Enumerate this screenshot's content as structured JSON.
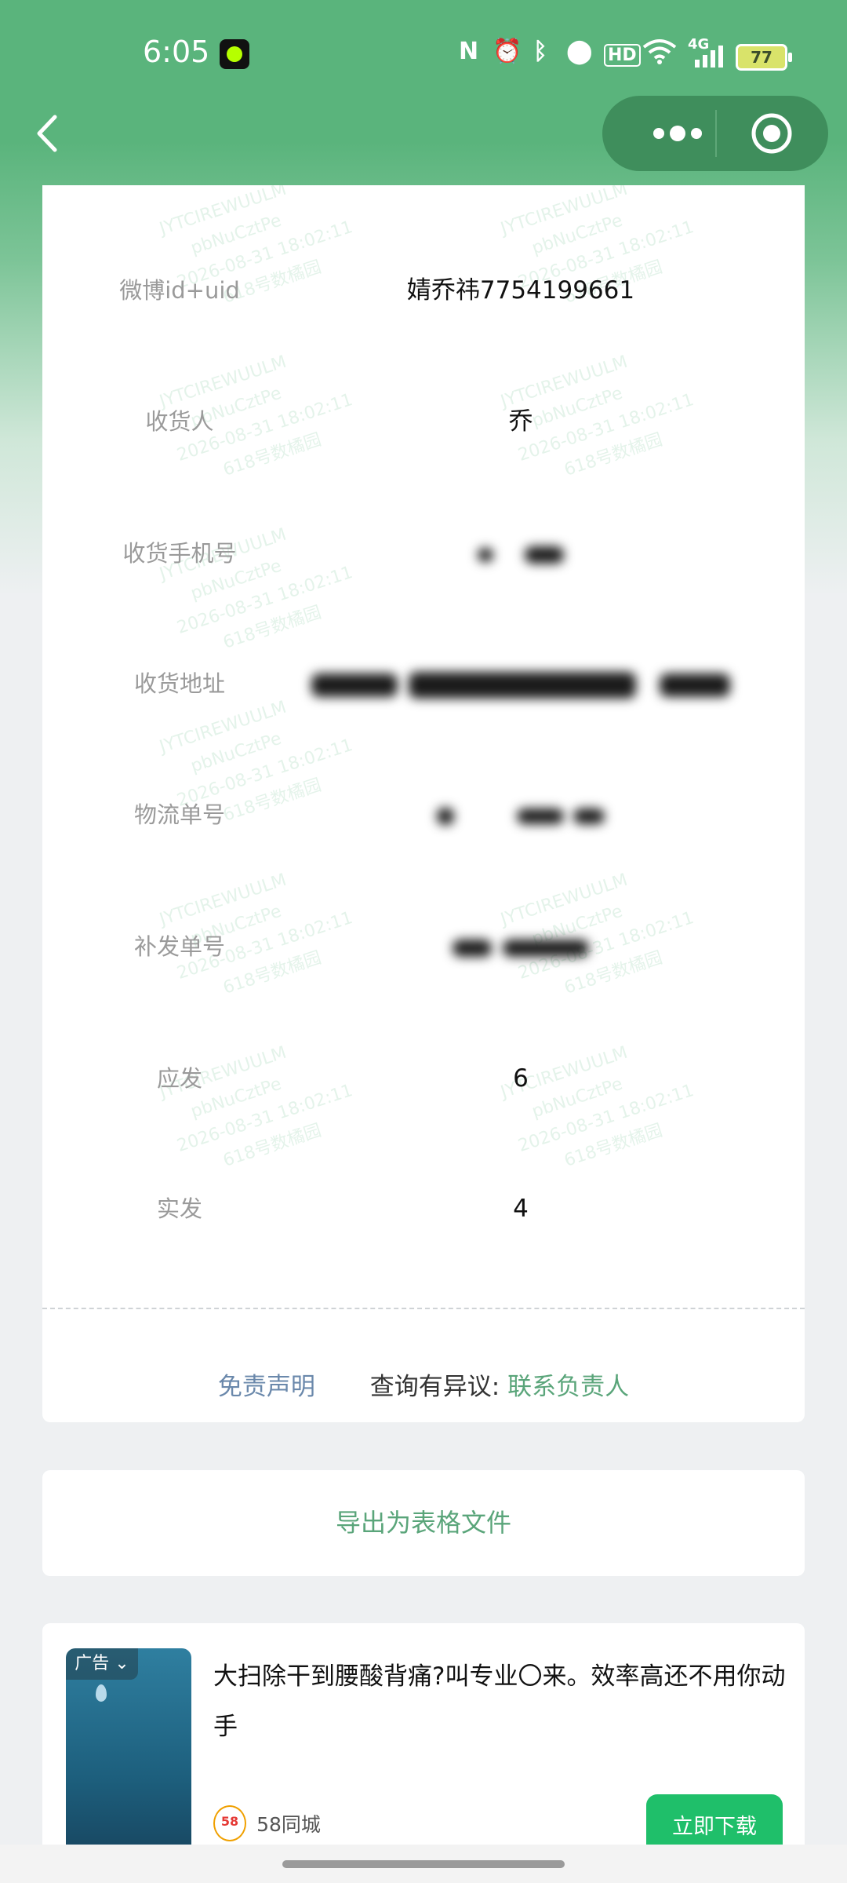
{
  "status_bar": {
    "time": "6:05",
    "nfc_icon": "nfc-icon",
    "alarm_icon": "alarm-icon",
    "bluetooth_icon": "bluetooth-icon",
    "location_icon": "location-icon",
    "hd_label": "HD",
    "wifi_icon": "wifi-icon",
    "network_label": "4G",
    "battery": "77"
  },
  "nav": {
    "back_icon": "chevron-left-icon",
    "more_icon": "more-dots-icon",
    "close_icon": "target-icon"
  },
  "watermark": {
    "line1": "JYTCIREWUULM",
    "line2": "pbNuCztPe",
    "line3": "2026-08-31 18:02:11",
    "line4": "618号数橘园"
  },
  "details": {
    "rows": [
      {
        "label": "微博id+uid",
        "value": "婧乔祎7754199661"
      },
      {
        "label": "收货人",
        "value": "乔"
      },
      {
        "label": "收货手机号",
        "value": ""
      },
      {
        "label": "收货地址",
        "value": ""
      },
      {
        "label": "物流单号",
        "value": ""
      },
      {
        "label": "补发单号",
        "value": ""
      },
      {
        "label": "应发",
        "value": "6"
      },
      {
        "label": "实发",
        "value": "4"
      }
    ]
  },
  "footer_links": {
    "disclaimer": "免责声明",
    "query": "查询有异议:",
    "contact": "联系负责人"
  },
  "export": {
    "label": "导出为表格文件"
  },
  "ad": {
    "tag": "广告",
    "title": "大扫除干到腰酸背痛?叫专业〇来。效率高还不用你动手",
    "brand_logo": "58",
    "brand_name": "58同城",
    "download": "立即下载"
  },
  "colors": {
    "brand_green": "#5ab47c",
    "link_green": "#5aa57a",
    "link_blue": "#6a88ab",
    "download_green": "#1fbf6a"
  }
}
